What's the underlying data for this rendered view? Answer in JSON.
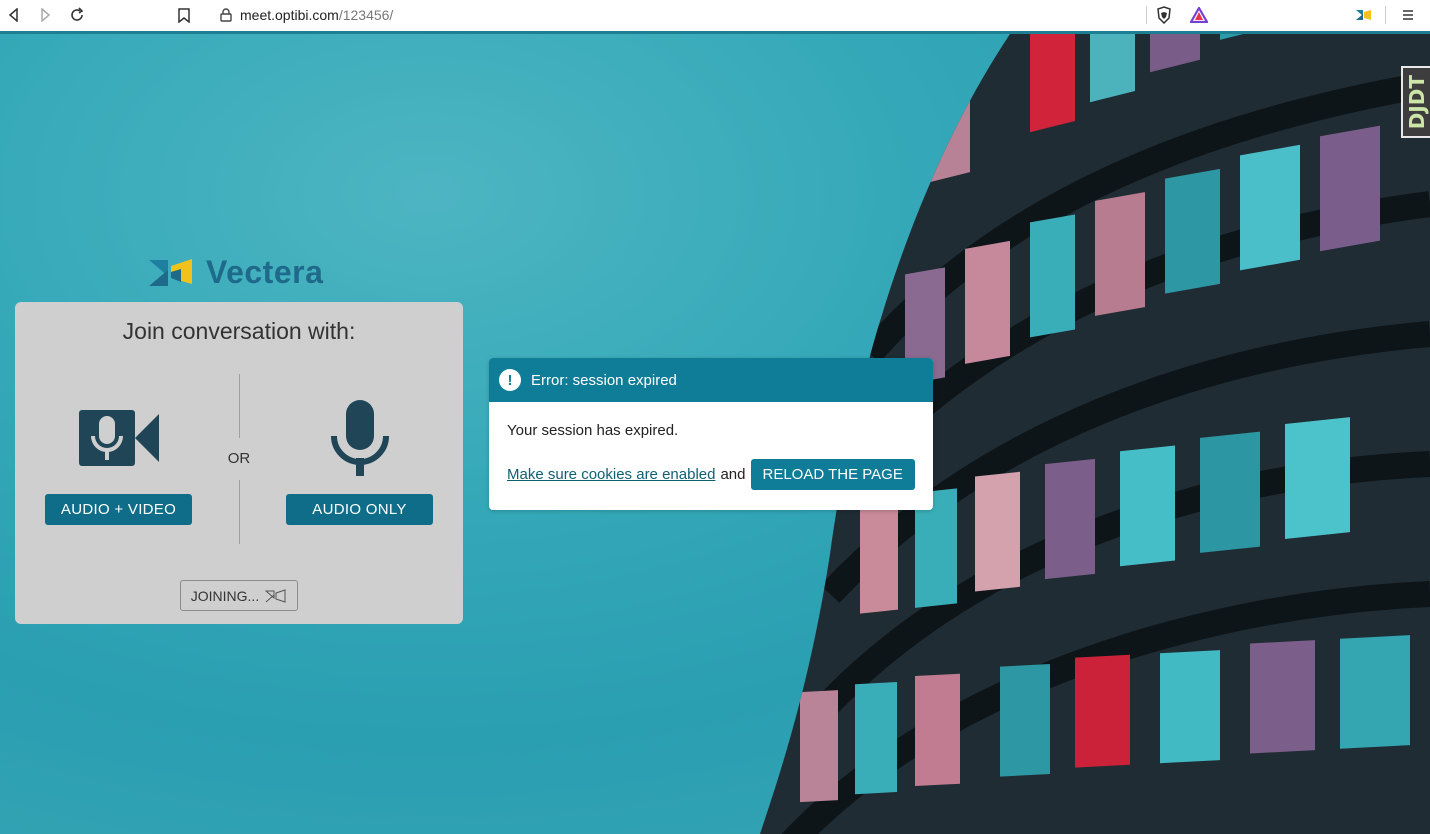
{
  "browser": {
    "url_host": "meet.optibi.com",
    "url_path": "/123456/"
  },
  "logo": {
    "text": "Vectera"
  },
  "join_panel": {
    "title": "Join conversation with:",
    "or_label": "OR",
    "audio_video_label": "AUDIO + VIDEO",
    "audio_only_label": "AUDIO ONLY",
    "joining_label": "JOINING..."
  },
  "dialog": {
    "title": "Error: session expired",
    "message": "Your session has expired.",
    "cookies_link": "Make sure cookies are enabled",
    "and_text": "and",
    "reload_label": "RELOAD THE PAGE"
  },
  "badge": {
    "text": "DJDT"
  },
  "colors": {
    "brand": "#0f6d8a",
    "dialog_header": "#0f7c98",
    "panel_bg": "#cfcfcf"
  }
}
